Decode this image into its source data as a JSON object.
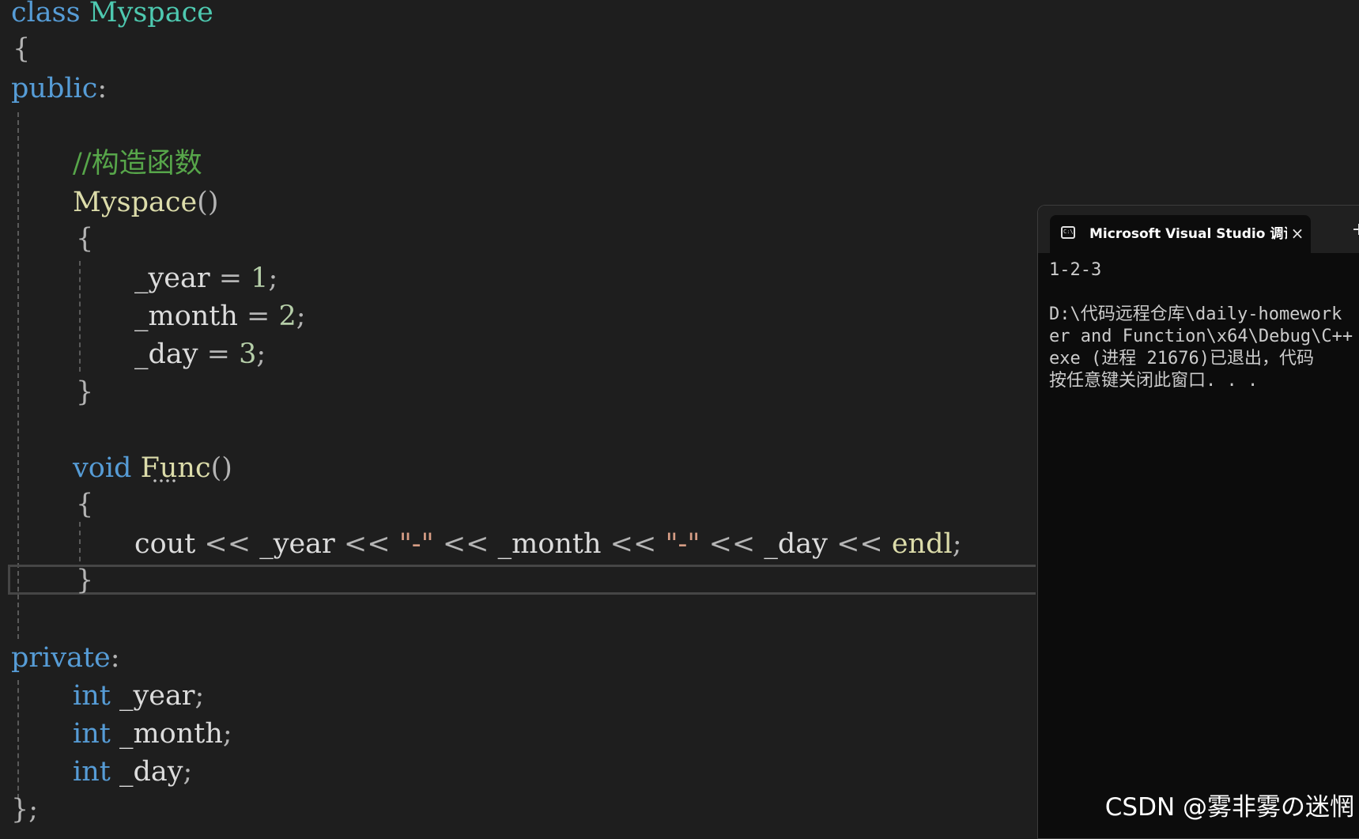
{
  "code": {
    "l1": {
      "kw": "class",
      "name": "Myspace"
    },
    "l2": {
      "brace": "{"
    },
    "l3": {
      "kw": "public",
      "colon": ":"
    },
    "l4": {
      "comment": "//构造函数"
    },
    "l5": {
      "fn": "Myspace",
      "paren": "()"
    },
    "l6": {
      "brace": "{"
    },
    "l7": {
      "var": "_year",
      "op": " = ",
      "num": "1",
      "semi": ";"
    },
    "l8": {
      "var": "_month",
      "op": " = ",
      "num": "2",
      "semi": ";"
    },
    "l9": {
      "var": "_day",
      "op": " = ",
      "num": "3",
      "semi": ";"
    },
    "l10": {
      "brace": "}"
    },
    "l11": {
      "kw": "void",
      "fn": "Func",
      "paren": "()"
    },
    "l12": {
      "brace": "{"
    },
    "l13": {
      "cout": "cout",
      "op": " << ",
      "v1": "_year",
      "s1": "\"-\"",
      "v2": "_month",
      "s2": "\"-\"",
      "v3": "_day",
      "endl": "endl",
      "semi": ";"
    },
    "l14": {
      "brace": "}"
    },
    "l15": {
      "kw": "private",
      "colon": ":"
    },
    "l16": {
      "kw": "int",
      "var": "_year",
      "semi": ";"
    },
    "l17": {
      "kw": "int",
      "var": "_month",
      "semi": ";"
    },
    "l18": {
      "kw": "int",
      "var": "_day",
      "semi": ";"
    },
    "l19": {
      "brace": "}",
      "semi": ";"
    }
  },
  "console": {
    "title": "Microsoft Visual Studio 调试控制台",
    "close": "×",
    "new_tab": "+",
    "output": "1-2-3",
    "path_line1": "D:\\代码远程仓库\\daily-homework",
    "path_line2": "er and Function\\x64\\Debug\\C++",
    "path_line3": "exe (进程 21676)已退出，代码",
    "prompt": "按任意键关闭此窗口. . ."
  },
  "watermark": "CSDN @雾非雾の迷惘",
  "colors": {
    "keyword": "#569cd6",
    "class": "#4ec9b0",
    "function": "#dcdcaa",
    "comment": "#57a64a",
    "number": "#b5cea8",
    "string": "#d69d85",
    "background": "#1e1e1e"
  }
}
